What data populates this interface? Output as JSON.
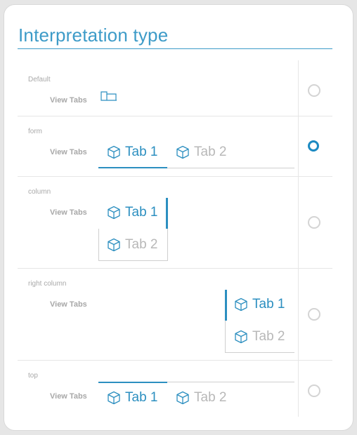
{
  "panel": {
    "title": "Interpretation type"
  },
  "options": [
    {
      "label": "Default",
      "view_tabs_label": "View Tabs",
      "selected": false
    },
    {
      "label": "form",
      "view_tabs_label": "View Tabs",
      "selected": true,
      "tabs": [
        {
          "label": "Tab 1",
          "active": true
        },
        {
          "label": "Tab 2",
          "active": false
        }
      ]
    },
    {
      "label": "column",
      "view_tabs_label": "View Tabs",
      "selected": false,
      "tabs": [
        {
          "label": "Tab 1",
          "active": true
        },
        {
          "label": "Tab 2",
          "active": false
        }
      ]
    },
    {
      "label": "right column",
      "view_tabs_label": "View Tabs",
      "selected": false,
      "tabs": [
        {
          "label": "Tab 1",
          "active": true
        },
        {
          "label": "Tab 2",
          "active": false
        }
      ]
    },
    {
      "label": "top",
      "view_tabs_label": "View Tabs",
      "selected": false,
      "tabs": [
        {
          "label": "Tab 1",
          "active": true
        },
        {
          "label": "Tab 2",
          "active": false
        }
      ]
    }
  ],
  "icons": {
    "tab": "cube-icon",
    "default": "folder-tabs-icon"
  },
  "colors": {
    "accent": "#2c8fc0",
    "inactive": "#b8b8b8",
    "radio_selected": "#1c8ac2"
  }
}
